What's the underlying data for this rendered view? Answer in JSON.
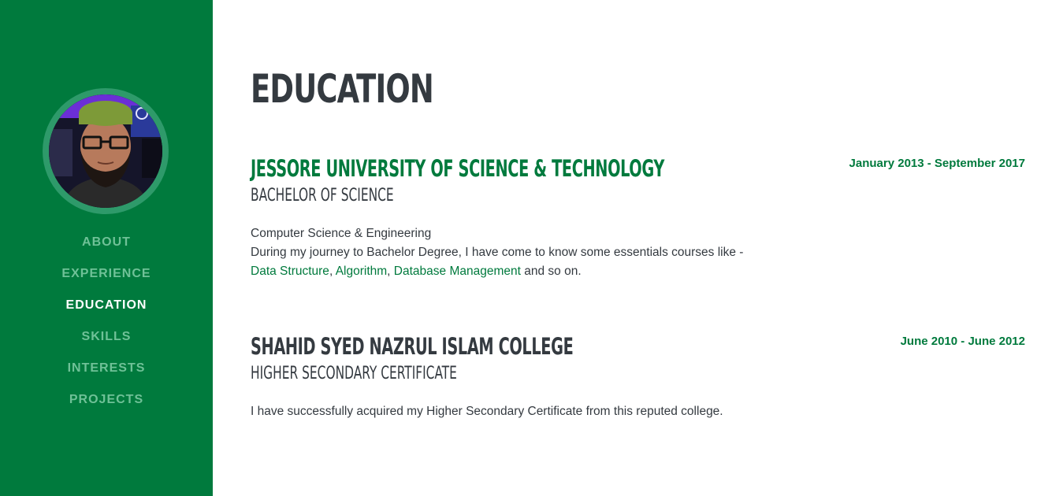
{
  "nav": {
    "items": [
      "About",
      "Experience",
      "Education",
      "Skills",
      "Interests",
      "Projects"
    ],
    "active": "Education"
  },
  "main": {
    "title": "Education",
    "entries": [
      {
        "institution": "Jessore University of Science & Technology",
        "degree": "Bachelor of Science",
        "date": "January 2013 - September 2017",
        "field": "Computer Science & Engineering",
        "description": "During my journey to Bachelor Degree, I have come to know some essentials courses like -",
        "courses": [
          "Data Structure",
          "Algorithm",
          "Database Management"
        ],
        "sep": ", ",
        "suffix": " and so on."
      },
      {
        "institution": "Shahid Syed Nazrul Islam College",
        "degree": "Higher Secondary Certificate",
        "date": "June 2010 - June 2012",
        "description": "I have successfully acquired my Higher Secondary Certificate from this reputed college."
      }
    ]
  },
  "colors": {
    "sidebar": "#007a3d",
    "accent": "#007a3d",
    "nav_inactive": "#6fc197",
    "text": "#343a40"
  },
  "icons": {
    "profile": "profile-photo"
  }
}
